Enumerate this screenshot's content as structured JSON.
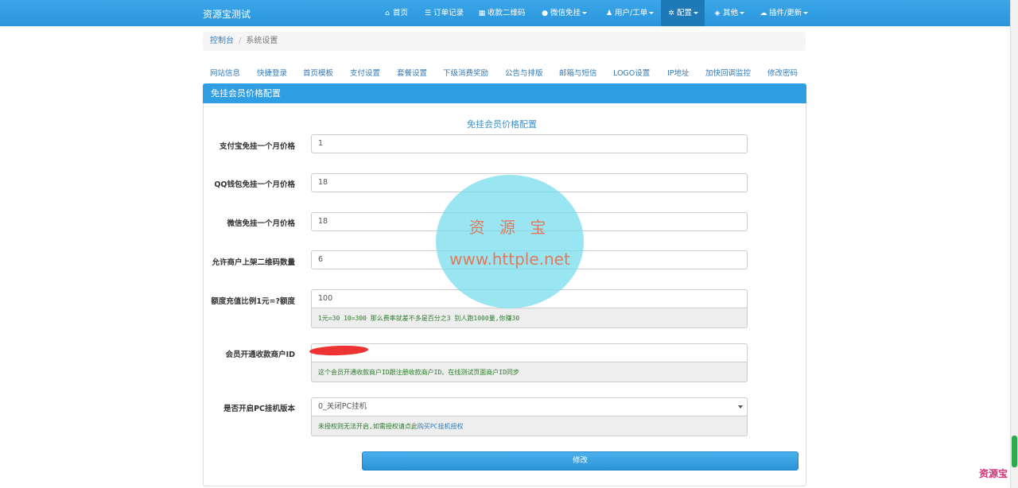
{
  "navbar": {
    "brand": "资源宝测试",
    "items": [
      {
        "label": "首页",
        "icon": "home-icon",
        "glyph": "⌂"
      },
      {
        "label": "订单记录",
        "icon": "list-icon",
        "glyph": "☰"
      },
      {
        "label": "收款二维码",
        "icon": "qrcode-icon",
        "glyph": "▦"
      },
      {
        "label": "微信免挂",
        "icon": "wechat-icon",
        "glyph": "●"
      },
      {
        "label": "用户/工单",
        "icon": "user-icon",
        "glyph": "♟"
      },
      {
        "label": "配置",
        "icon": "gear-icon",
        "glyph": "✲"
      },
      {
        "label": "其他",
        "icon": "cube-icon",
        "glyph": "◈"
      },
      {
        "label": "插件/更新",
        "icon": "cloud-icon",
        "glyph": "☁"
      }
    ]
  },
  "breadcrumb": {
    "home": "控制台",
    "current": "系统设置"
  },
  "tabs": [
    "网站信息",
    "快捷登录",
    "首页模板",
    "支付设置",
    "套餐设置",
    "下级消费奖励",
    "公告与排版",
    "邮箱与短信",
    "LOGO设置",
    "IP地址",
    "加快回调监控",
    "修改密码"
  ],
  "panel": {
    "title": "免挂会员价格配置",
    "form_title": "免挂会员价格配置"
  },
  "fields": {
    "alipay_price": {
      "label": "支付宝免挂一个月价格",
      "value": "1"
    },
    "qq_price": {
      "label": "QQ钱包免挂一个月价格",
      "value": "18"
    },
    "wechat_price": {
      "label": "微信免挂一个月价格",
      "value": "18"
    },
    "qrcode_count": {
      "label": "允许商户上架二维码数量",
      "value": "6"
    },
    "quota_ratio": {
      "label": "额度充值比例1元=?额度",
      "value": "100",
      "help": "1元=30  10=300  那么费率就差不多是百分之3 别人跑1000量,你赚30"
    },
    "merchant_id": {
      "label": "会员开通收款商户ID",
      "value": "",
      "help": "这个会员开通收款商户ID跟注册收款商户ID、在线测试页面商户ID同步"
    },
    "pc_version": {
      "label": "是否开启PC挂机版本",
      "value": "0_关闭PC挂机",
      "help_text": "未授权则无法开启,如需授权请点此",
      "help_link": "购买PC挂机授权"
    }
  },
  "submit_label": "修改",
  "watermark": {
    "line1": "资 源 宝",
    "line2": "www.httple.net"
  },
  "corner_logo": "资源宝"
}
